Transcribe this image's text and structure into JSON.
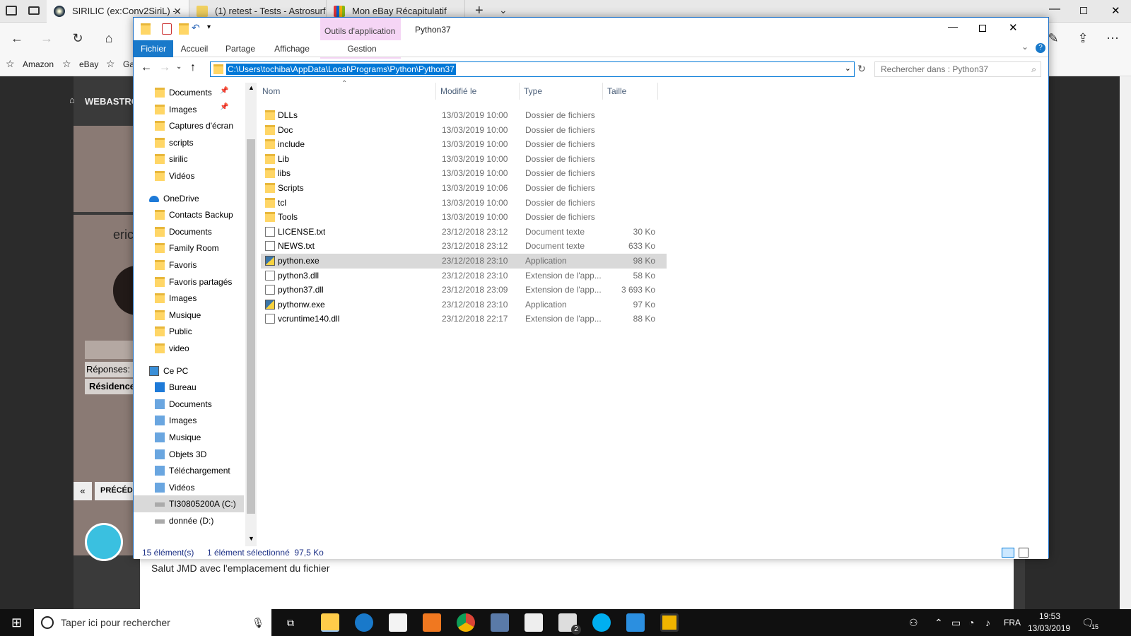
{
  "browser": {
    "tabs": [
      {
        "title": "SIRILIC (ex:Conv2SiriL) -",
        "active": true
      },
      {
        "title": "(1) retest - Tests - Astrosurf",
        "active": false
      },
      {
        "title": "Mon eBay Récapitulatif",
        "active": false
      }
    ],
    "favorites": [
      "Amazon",
      "eBay",
      "Ga"
    ]
  },
  "webpage": {
    "site": "WEBASTRO",
    "user": "eric",
    "responses_label": "Réponses:",
    "residence_label": "Résidence",
    "prev_label": "PRÉCÉDE",
    "post_text": "Salut JMD avec l'emplacement du fichier"
  },
  "explorer": {
    "contextual_tab": "Outils d'application",
    "window_title": "Python37",
    "ribbon_tabs": [
      "Fichier",
      "Accueil",
      "Partage",
      "Affichage",
      "Gestion"
    ],
    "address": "C:\\Users\\tochiba\\AppData\\Local\\Programs\\Python\\Python37",
    "search_placeholder": "Rechercher dans : Python37",
    "nav": {
      "quick": [
        {
          "label": "Documents",
          "pinned": true
        },
        {
          "label": "Images",
          "pinned": true
        },
        {
          "label": "Captures d'écran"
        },
        {
          "label": "scripts"
        },
        {
          "label": "sirilic"
        },
        {
          "label": "Vidéos"
        }
      ],
      "onedrive_label": "OneDrive",
      "onedrive": [
        "Contacts Backup",
        "Documents",
        "Family Room",
        "Favoris",
        "Favoris partagés",
        "Images",
        "Musique",
        "Public",
        "video"
      ],
      "pc_label": "Ce PC",
      "pc": [
        "Bureau",
        "Documents",
        "Images",
        "Musique",
        "Objets 3D",
        "Téléchargement",
        "Vidéos",
        "TI30805200A (C:)",
        "donnée (D:)"
      ]
    },
    "columns": [
      "Nom",
      "Modifié le",
      "Type",
      "Taille"
    ],
    "files": [
      {
        "name": "DLLs",
        "date": "13/03/2019 10:00",
        "type": "Dossier de fichiers",
        "size": "",
        "icon": "folder"
      },
      {
        "name": "Doc",
        "date": "13/03/2019 10:00",
        "type": "Dossier de fichiers",
        "size": "",
        "icon": "folder"
      },
      {
        "name": "include",
        "date": "13/03/2019 10:00",
        "type": "Dossier de fichiers",
        "size": "",
        "icon": "folder"
      },
      {
        "name": "Lib",
        "date": "13/03/2019 10:00",
        "type": "Dossier de fichiers",
        "size": "",
        "icon": "folder"
      },
      {
        "name": "libs",
        "date": "13/03/2019 10:00",
        "type": "Dossier de fichiers",
        "size": "",
        "icon": "folder"
      },
      {
        "name": "Scripts",
        "date": "13/03/2019 10:06",
        "type": "Dossier de fichiers",
        "size": "",
        "icon": "folder"
      },
      {
        "name": "tcl",
        "date": "13/03/2019 10:00",
        "type": "Dossier de fichiers",
        "size": "",
        "icon": "folder"
      },
      {
        "name": "Tools",
        "date": "13/03/2019 10:00",
        "type": "Dossier de fichiers",
        "size": "",
        "icon": "folder"
      },
      {
        "name": "LICENSE.txt",
        "date": "23/12/2018 23:12",
        "type": "Document texte",
        "size": "30 Ko",
        "icon": "text"
      },
      {
        "name": "NEWS.txt",
        "date": "23/12/2018 23:12",
        "type": "Document texte",
        "size": "633 Ko",
        "icon": "text"
      },
      {
        "name": "python.exe",
        "date": "23/12/2018 23:10",
        "type": "Application",
        "size": "98 Ko",
        "icon": "python",
        "selected": true
      },
      {
        "name": "python3.dll",
        "date": "23/12/2018 23:10",
        "type": "Extension de l'app...",
        "size": "58 Ko",
        "icon": "dll"
      },
      {
        "name": "python37.dll",
        "date": "23/12/2018 23:09",
        "type": "Extension de l'app...",
        "size": "3 693 Ko",
        "icon": "dll"
      },
      {
        "name": "pythonw.exe",
        "date": "23/12/2018 23:10",
        "type": "Application",
        "size": "97 Ko",
        "icon": "python"
      },
      {
        "name": "vcruntime140.dll",
        "date": "23/12/2018 22:17",
        "type": "Extension de l'app...",
        "size": "88 Ko",
        "icon": "dll"
      }
    ],
    "status_count": "15 élément(s)",
    "status_selection": "1 élément sélectionné  97,5 Ko"
  },
  "taskbar": {
    "search_placeholder": "Taper ici pour rechercher",
    "lang": "FRA",
    "time": "19:53",
    "date": "13/03/2019",
    "mail_badge": "2",
    "notif_count": "15"
  },
  "colors": {
    "accent": "#0078d7",
    "contextual": "#f5d5f5",
    "selection": "#d9d9d9"
  }
}
